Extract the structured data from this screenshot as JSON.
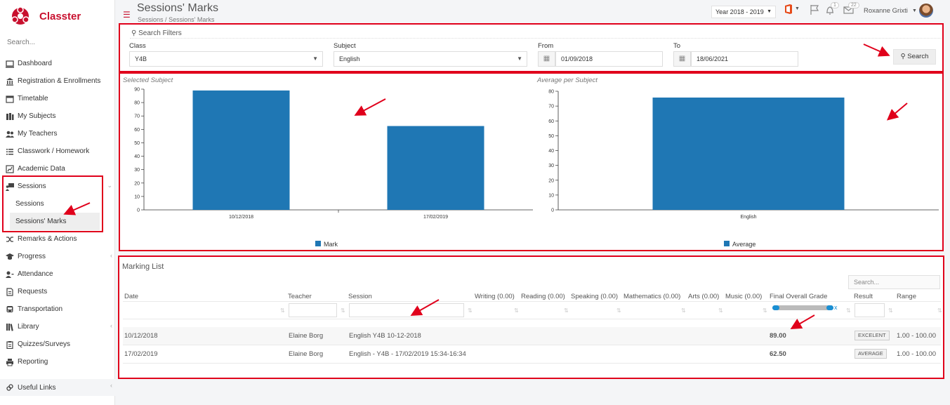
{
  "app": {
    "name": "Classter"
  },
  "sidebar": {
    "search_placeholder": "Search...",
    "items": [
      {
        "label": "Dashboard",
        "icon": "laptop-icon"
      },
      {
        "label": "Registration & Enrollments",
        "icon": "institution-icon"
      },
      {
        "label": "Timetable",
        "icon": "calendar-icon"
      },
      {
        "label": "My Subjects",
        "icon": "books-icon"
      },
      {
        "label": "My Teachers",
        "icon": "users-icon"
      },
      {
        "label": "Classwork / Homework",
        "icon": "list-icon"
      },
      {
        "label": "Academic Data",
        "icon": "chart-icon"
      },
      {
        "label": "Sessions",
        "icon": "presentation-icon"
      },
      {
        "label": "Remarks & Actions",
        "icon": "shuffle-icon"
      },
      {
        "label": "Progress",
        "icon": "graduation-cap-icon"
      },
      {
        "label": "Attendance",
        "icon": "user-check-icon"
      },
      {
        "label": "Requests",
        "icon": "file-icon"
      },
      {
        "label": "Transportation",
        "icon": "bus-icon"
      },
      {
        "label": "Library",
        "icon": "library-icon"
      },
      {
        "label": "Quizzes/Surveys",
        "icon": "clipboard-icon"
      },
      {
        "label": "Reporting",
        "icon": "print-icon"
      }
    ],
    "sessions_sub": [
      "Sessions",
      "Sessions' Marks"
    ],
    "useful_links": "Useful Links"
  },
  "header": {
    "title": "Sessions' Marks",
    "breadcrumb": [
      "Sessions",
      "/",
      "Sessions' Marks"
    ],
    "year": "Year 2018 - 2019",
    "notifications_count": "1",
    "messages_count": "22",
    "user": "Roxanne Grixti"
  },
  "filters": {
    "title": "Search Filters",
    "class_label": "Class",
    "class_value": "Y4B",
    "subject_label": "Subject",
    "subject_value": "English",
    "from_label": "From",
    "from_value": "01/09/2018",
    "to_label": "To",
    "to_value": "18/06/2021",
    "search_label": "Search"
  },
  "chart_data": [
    {
      "type": "bar",
      "title": "Selected Subject",
      "categories": [
        "10/12/2018",
        "17/02/2019"
      ],
      "series": [
        {
          "name": "Mark",
          "values": [
            89,
            62.5
          ]
        }
      ],
      "ylim": [
        0,
        90
      ],
      "yticks": [
        0,
        10,
        20,
        30,
        40,
        50,
        60,
        70,
        80,
        90
      ],
      "legend": "bottom",
      "color": "#1f77b4"
    },
    {
      "type": "bar",
      "title": "Average per Subject",
      "categories": [
        "English"
      ],
      "series": [
        {
          "name": "Average",
          "values": [
            75.75
          ]
        }
      ],
      "ylim": [
        0,
        80
      ],
      "yticks": [
        0,
        10,
        20,
        30,
        40,
        50,
        60,
        70,
        80
      ],
      "legend": "bottom",
      "color": "#1f77b4"
    }
  ],
  "marking": {
    "title": "Marking List",
    "search_placeholder": "Search...",
    "columns": [
      "Date",
      "Teacher",
      "Session",
      "Writing (0.00)",
      "Reading (0.00)",
      "Speaking (0.00)",
      "Mathematics (0.00)",
      "Arts (0.00)",
      "Music (0.00)",
      "Final Overall Grade",
      "Result",
      "Range"
    ],
    "slider_clear": "x",
    "rows": [
      {
        "date": "10/12/2018",
        "teacher": "Elaine Borg",
        "session": "English Y4B 10-12-2018",
        "grade": "89.00",
        "result": "EXCELENT",
        "range": "1.00 - 100.00"
      },
      {
        "date": "17/02/2019",
        "teacher": "Elaine Borg",
        "session": "English - Y4B - 17/02/2019 15:34-16:34",
        "grade": "62.50",
        "result": "AVERAGE",
        "range": "1.00 - 100.00"
      }
    ]
  },
  "colors": {
    "brand": "#c8102e",
    "highlight": "#e0001b",
    "bar": "#1f77b4"
  }
}
